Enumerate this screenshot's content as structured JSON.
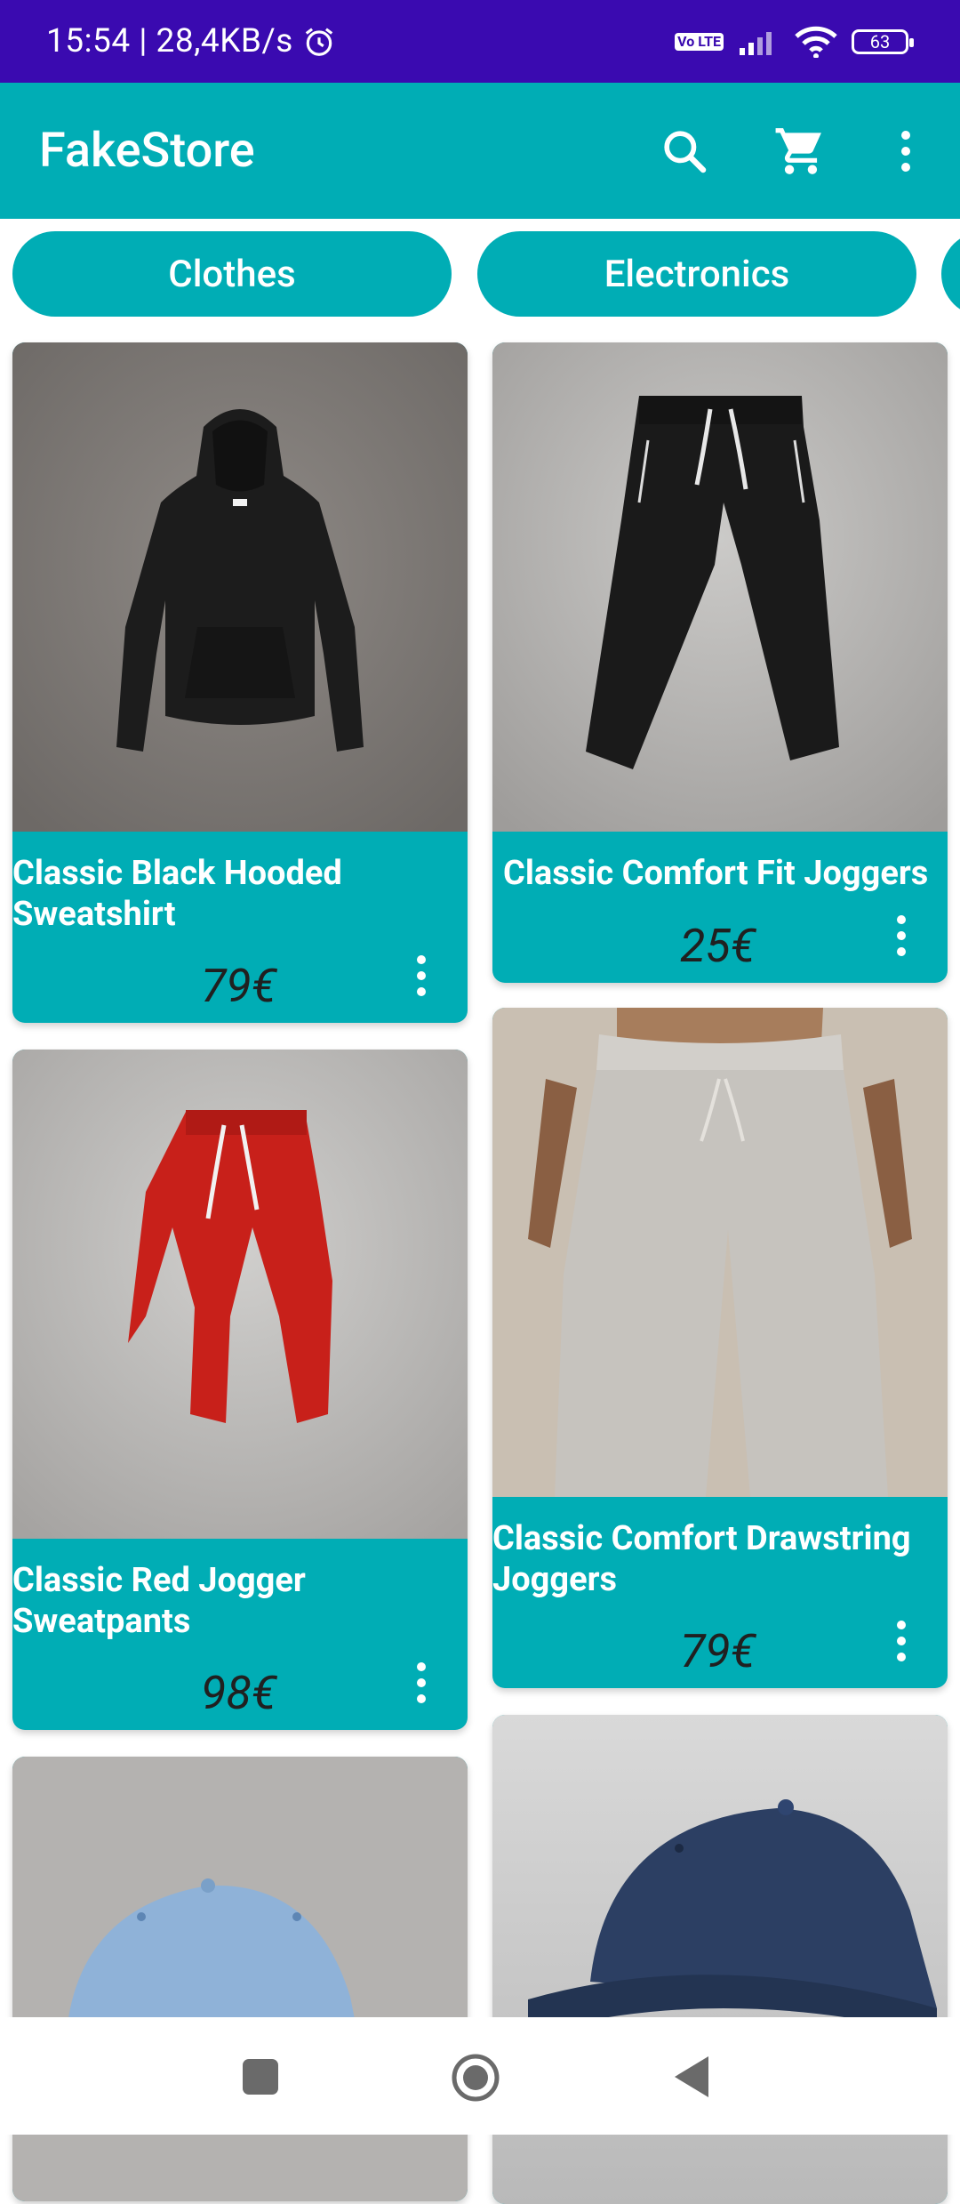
{
  "status_bar": {
    "time": "15:54 | 28,4KB/s",
    "battery": "63",
    "volte": "Vo LTE"
  },
  "app_bar": {
    "title": "FakeStore"
  },
  "categories": [
    {
      "label": "Clothes"
    },
    {
      "label": "Electronics"
    }
  ],
  "products": [
    {
      "title": "Classic Black Hooded Sweatshirt",
      "price": "79€"
    },
    {
      "title": "Classic Comfort Fit Joggers",
      "price": "25€"
    },
    {
      "title": "Classic Red Jogger Sweatpants",
      "price": "98€"
    },
    {
      "title": "Classic Comfort Drawstring Joggers",
      "price": "79€"
    }
  ],
  "colors": {
    "status_bar": "#3a0ab0",
    "accent": "#00adb5"
  }
}
